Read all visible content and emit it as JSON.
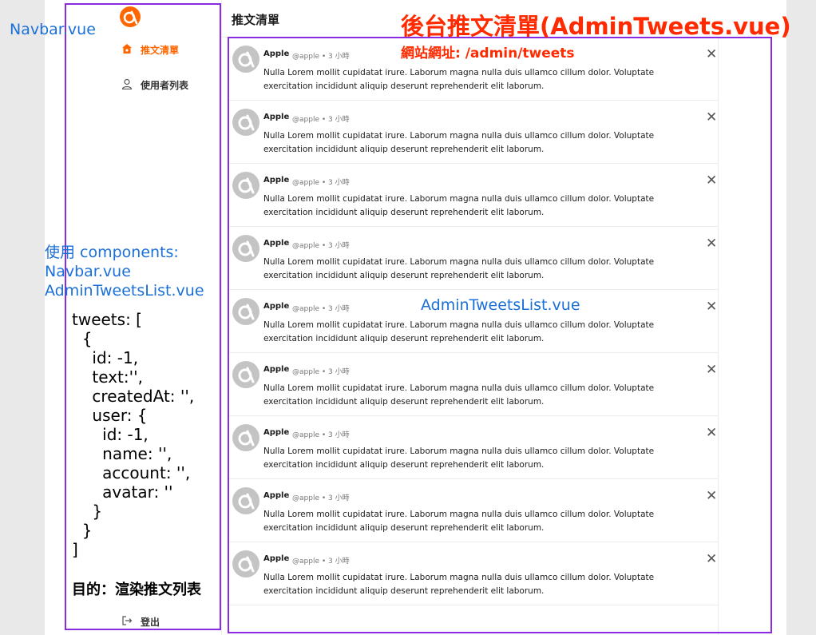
{
  "navbar": {
    "tweets_label": "推文清單",
    "users_label": "使用者列表",
    "logout_label": "登出"
  },
  "main": {
    "page_title": "推文清單"
  },
  "tweets": [
    {
      "name": "Apple",
      "meta": "@apple • 3 小時",
      "text": "Nulla Lorem mollit cupidatat irure. Laborum magna nulla duis ullamco cillum dolor. Voluptate exercitation incididunt aliquip deserunt reprehenderit elit laborum."
    },
    {
      "name": "Apple",
      "meta": "@apple • 3 小時",
      "text": "Nulla Lorem mollit cupidatat irure. Laborum magna nulla duis ullamco cillum dolor. Voluptate exercitation incididunt aliquip deserunt reprehenderit elit laborum."
    },
    {
      "name": "Apple",
      "meta": "@apple • 3 小時",
      "text": "Nulla Lorem mollit cupidatat irure. Laborum magna nulla duis ullamco cillum dolor. Voluptate exercitation incididunt aliquip deserunt reprehenderit elit laborum."
    },
    {
      "name": "Apple",
      "meta": "@apple • 3 小時",
      "text": "Nulla Lorem mollit cupidatat irure. Laborum magna nulla duis ullamco cillum dolor. Voluptate exercitation incididunt aliquip deserunt reprehenderit elit laborum."
    },
    {
      "name": "Apple",
      "meta": "@apple • 3 小時",
      "text": "Nulla Lorem mollit cupidatat irure. Laborum magna nulla duis ullamco cillum dolor. Voluptate exercitation incididunt aliquip deserunt reprehenderit elit laborum."
    },
    {
      "name": "Apple",
      "meta": "@apple • 3 小時",
      "text": "Nulla Lorem mollit cupidatat irure. Laborum magna nulla duis ullamco cillum dolor. Voluptate exercitation incididunt aliquip deserunt reprehenderit elit laborum."
    },
    {
      "name": "Apple",
      "meta": "@apple • 3 小時",
      "text": "Nulla Lorem mollit cupidatat irure. Laborum magna nulla duis ullamco cillum dolor. Voluptate exercitation incididunt aliquip deserunt reprehenderit elit laborum."
    },
    {
      "name": "Apple",
      "meta": "@apple • 3 小時",
      "text": "Nulla Lorem mollit cupidatat irure. Laborum magna nulla duis ullamco cillum dolor. Voluptate exercitation incididunt aliquip deserunt reprehenderit elit laborum."
    },
    {
      "name": "Apple",
      "meta": "@apple • 3 小時",
      "text": "Nulla Lorem mollit cupidatat irure. Laborum magna nulla duis ullamco cillum dolor. Voluptate exercitation incididunt aliquip deserunt reprehenderit elit laborum."
    }
  ],
  "annotations": {
    "navbar_label": "Navbar.vue",
    "title": "後台推文清單(AdminTweets.vue)",
    "url": "網站網址:  /admin/tweets",
    "components_lines": [
      "使用 components:",
      "Navbar.vue",
      "AdminTweetsList.vue"
    ],
    "list_label": "AdminTweetsList.vue",
    "code_lines": [
      "tweets: [",
      "  {",
      "    id: -1,",
      "    text:'',",
      "    createdAt: '',",
      "    user: {",
      "      id: -1,",
      "      name: '',",
      "      account: '',",
      "      avatar: ''",
      "    }",
      "  }",
      "]"
    ],
    "purpose": "目的：渲染推文列表"
  },
  "colors": {
    "brand": "#ff6600",
    "annotation_box": "#8a2be2",
    "annotation_blue": "#1a6fd8",
    "annotation_red": "#ff2a00"
  },
  "icons": {
    "logo": "ac-logo-icon",
    "tweets": "home-icon",
    "users": "user-icon",
    "logout": "logout-icon",
    "delete": "close-icon"
  }
}
